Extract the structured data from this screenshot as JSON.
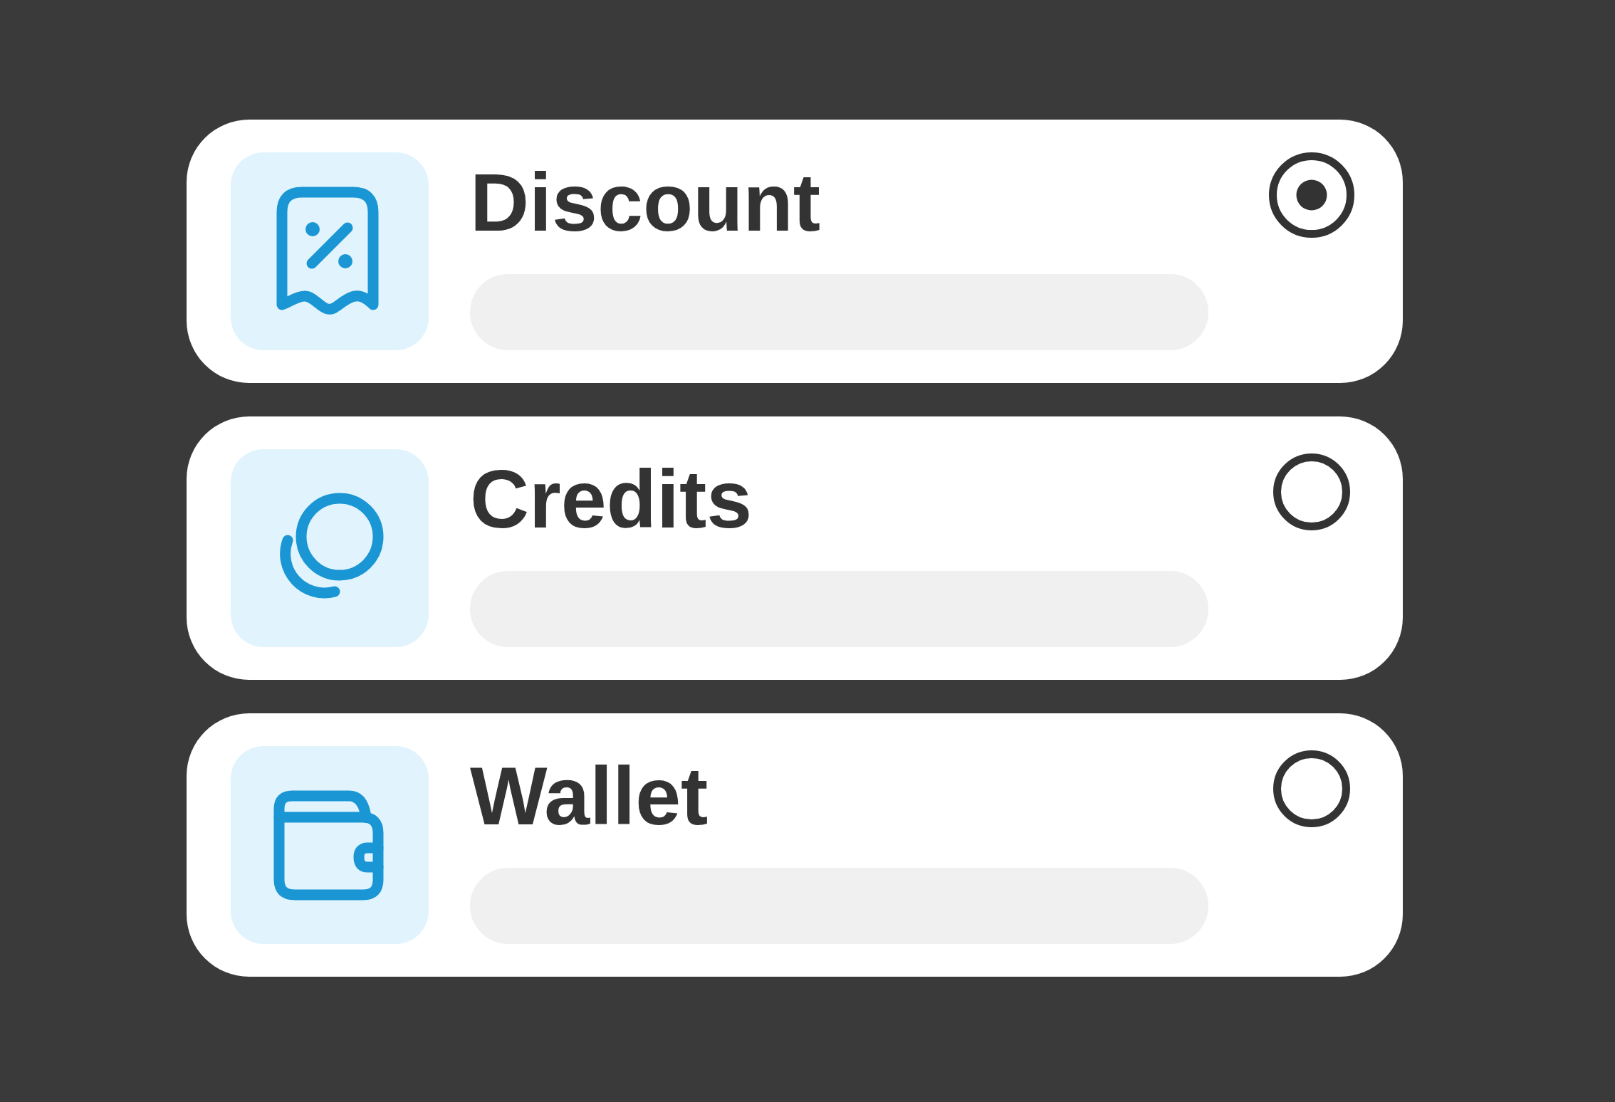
{
  "options": [
    {
      "label": "Discount",
      "selected": true
    },
    {
      "label": "Credits",
      "selected": false
    },
    {
      "label": "Wallet",
      "selected": false
    }
  ]
}
